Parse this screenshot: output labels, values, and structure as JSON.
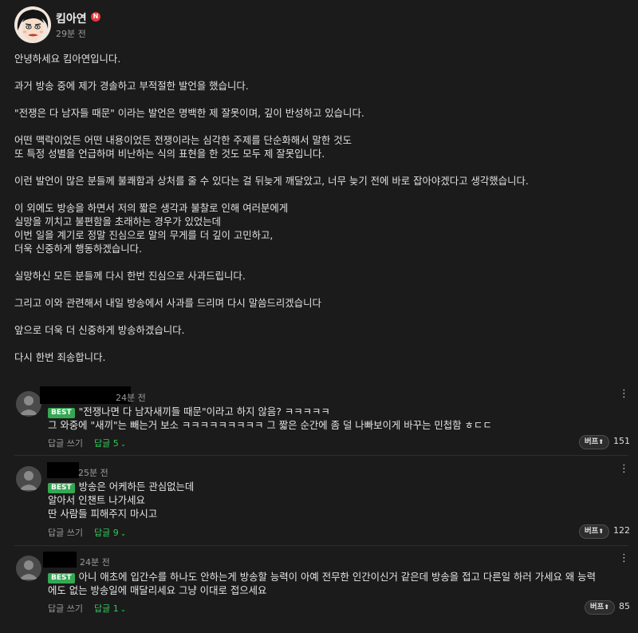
{
  "post": {
    "author": "킴아연",
    "badge": "N",
    "time": "29분 전",
    "lines": [
      "안녕하세요 킴아연입니다.",
      "",
      "과거 방송 중에 제가 경솔하고 부적절한 발언을 했습니다.",
      "",
      "\"전쟁은 다 남자들 때문\" 이라는 발언은 명백한 제 잘못이며, 깊이 반성하고 있습니다.",
      "",
      "어떤 맥락이었든 어떤 내용이었든 전쟁이라는 심각한 주제를 단순화해서 말한 것도",
      "또 특정 성별을 언급하며 비난하는 식의 표현을 한 것도 모두 제 잘못입니다.",
      "",
      "이런 발언이 많은 분들께 불쾌함과 상처를 줄 수 있다는 걸 뒤늦게 깨달았고, 너무 늦기 전에 바로 잡아야겠다고 생각했습니다.",
      "",
      "이 외에도 방송을 하면서 저의 짧은 생각과 불찰로 인해 여러분에게",
      "실망을 끼치고 불편함을 초래하는 경우가 있었는데",
      "이번 일을 계기로 정말 진심으로 말의 무게를 더 깊이 고민하고,",
      "더욱 신중하게 행동하겠습니다.",
      "",
      "실망하신 모든 분들께 다시 한번 진심으로 사과드립니다.",
      "",
      "그리고 이와 관련해서 내일 방송에서 사과를 드리며 다시 말씀드리겠습니다",
      "",
      "앞으로 더욱 더 신중하게 방송하겠습니다.",
      "",
      "다시 한번 죄송합니다."
    ]
  },
  "comments": [
    {
      "time": "24분 전",
      "best": "BEST",
      "lines": [
        "\"전쟁나면 다 남자새끼들 때문\"이라고 하지 않음? ㅋㅋㅋㅋㅋ",
        "그 와중에 \"새끼\"는 빼는거 보소 ㅋㅋㅋㅋㅋㅋㅋㅋㅋ 그 짧은 순간에 좀 덜 나빠보이게 바꾸는 민첩함 ㅎㄷㄷ"
      ],
      "reply_label": "답글 쓰기",
      "reply_count": "답글 5",
      "buff_label": "버프",
      "buff_count": "151"
    },
    {
      "time": "25분 전",
      "best": "BEST",
      "lines": [
        "방송은 어케하든 관심없는데",
        "알아서 인챈트 나가세요",
        "딴 사람들 피해주지 마시고"
      ],
      "reply_label": "답글 쓰기",
      "reply_count": "답글 9",
      "buff_label": "버프",
      "buff_count": "122"
    },
    {
      "time": "24분 전",
      "best": "BEST",
      "lines": [
        "아니 애초에 입간수를 하나도 안하는게 방송할 능력이 아예 전무한 인간이신거 같은데 방송을 접고 다른일 하러 가세요 왜 능력",
        "에도 없는 방송일에 매달리세요 그냥 이대로 접으세요"
      ],
      "reply_label": "답글 쓰기",
      "reply_count": "답글 1",
      "buff_label": "버프",
      "buff_count": "85"
    }
  ],
  "icons": {
    "more": "more-vertical-icon",
    "caret": "chevron-down-icon",
    "buff_arrow": "arrow-up-icon"
  },
  "colors": {
    "background": "#1b1b1b",
    "best": "#34a853",
    "reply_count": "#34c759",
    "badge": "#e5383b"
  }
}
